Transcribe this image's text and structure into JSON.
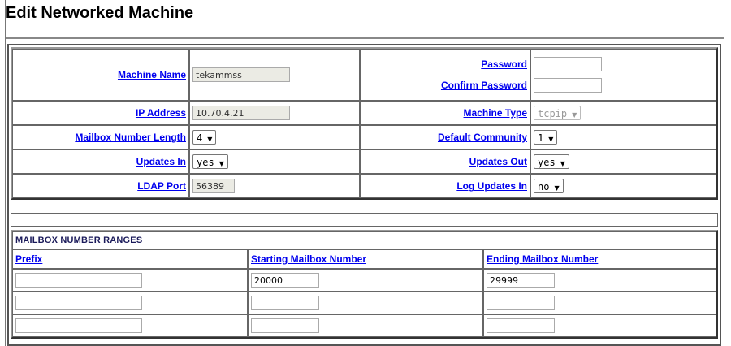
{
  "page": {
    "title": "Edit Networked Machine"
  },
  "form": {
    "machine_name": {
      "label": "Machine Name",
      "value": "tekammss"
    },
    "password": {
      "label": "Password",
      "value": ""
    },
    "confirm_password": {
      "label": "Confirm Password",
      "value": ""
    },
    "ip_address": {
      "label": "IP Address",
      "value": "10.70.4.21"
    },
    "machine_type": {
      "label": "Machine Type",
      "value": "tcpip"
    },
    "mailbox_number_length": {
      "label": "Mailbox Number Length",
      "value": "4"
    },
    "default_community": {
      "label": "Default Community",
      "value": "1"
    },
    "updates_in": {
      "label": "Updates In",
      "value": "yes"
    },
    "updates_out": {
      "label": "Updates Out",
      "value": "yes"
    },
    "ldap_port": {
      "label": "LDAP Port",
      "value": "56389"
    },
    "log_updates_in": {
      "label": "Log Updates In",
      "value": "no"
    }
  },
  "ranges": {
    "header": "MAILBOX NUMBER RANGES",
    "columns": [
      "Prefix",
      "Starting Mailbox Number",
      "Ending Mailbox Number"
    ],
    "rows": [
      {
        "prefix": "",
        "start": "20000",
        "end": "29999"
      },
      {
        "prefix": "",
        "start": "",
        "end": ""
      },
      {
        "prefix": "",
        "start": "",
        "end": ""
      }
    ]
  },
  "icons": {
    "dropdown_arrow": "▼"
  }
}
